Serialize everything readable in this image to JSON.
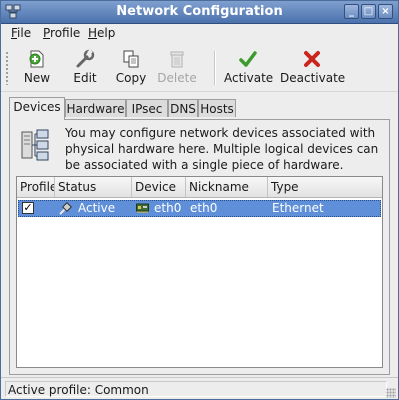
{
  "window": {
    "title": "Network Configuration",
    "controls": [
      "_",
      "□",
      "×"
    ]
  },
  "menu": [
    {
      "label": "File",
      "mnemonic": "F",
      "rest": "ile"
    },
    {
      "label": "Profile",
      "mnemonic": "P",
      "rest": "rofile"
    },
    {
      "label": "Help",
      "mnemonic": "H",
      "rest": "elp"
    }
  ],
  "toolbar": {
    "new": "New",
    "edit": "Edit",
    "copy": "Copy",
    "delete": "Delete",
    "activate": "Activate",
    "deactivate": "Deactivate"
  },
  "tabs": [
    {
      "label": "Devices",
      "active": true
    },
    {
      "label": "Hardware"
    },
    {
      "label": "IPsec"
    },
    {
      "label": "DNS"
    },
    {
      "label": "Hosts"
    }
  ],
  "devices": {
    "info": "You may configure network devices associated with physical hardware here.  Multiple logical devices can be associated with a single piece of hardware.",
    "columns": [
      "Profile",
      "Status",
      "Device",
      "Nickname",
      "Type"
    ],
    "rows": [
      {
        "profile_checked": true,
        "profile_mark": "✓",
        "status": "Active",
        "device": "eth0",
        "nickname": "eth0",
        "type": "Ethernet",
        "selected": true
      }
    ]
  },
  "status": {
    "text": "Active profile: Common"
  },
  "colors": {
    "titlebar": "#4b72ad",
    "selection": "#5e8fd8"
  }
}
